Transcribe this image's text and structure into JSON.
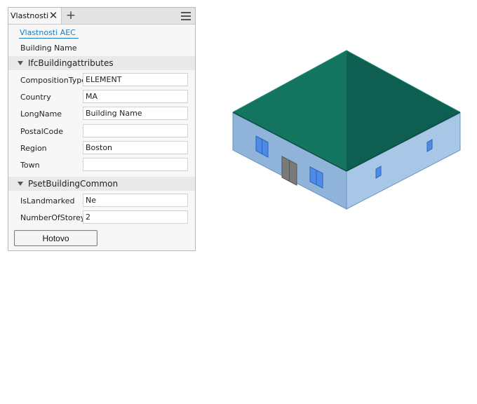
{
  "palette": {
    "tab_label": "Vlastnosti",
    "close_glyph": "✕",
    "add_glyph": "+",
    "aec_link": "Vlastnosti AEC",
    "building_name": "Building Name",
    "sections": [
      {
        "title": "IfcBuildingattributes",
        "rows": [
          {
            "label": "CompositionType",
            "value": "ELEMENT"
          },
          {
            "label": "Country",
            "value": "MA"
          },
          {
            "label": "LongName",
            "value": "Building Name"
          },
          {
            "label": "PostalCode",
            "value": ""
          },
          {
            "label": "Region",
            "value": "Boston"
          },
          {
            "label": "Town",
            "value": ""
          }
        ]
      },
      {
        "title": "PsetBuildingCommon",
        "rows": [
          {
            "label": "IsLandmarked",
            "value": "Ne"
          },
          {
            "label": "NumberOfStoreys",
            "value": "2"
          }
        ]
      }
    ],
    "done_label": "Hotovo"
  },
  "colors": {
    "link": "#1b7ec4",
    "roof": "#126a5c",
    "walls": "#8fb3d9"
  }
}
